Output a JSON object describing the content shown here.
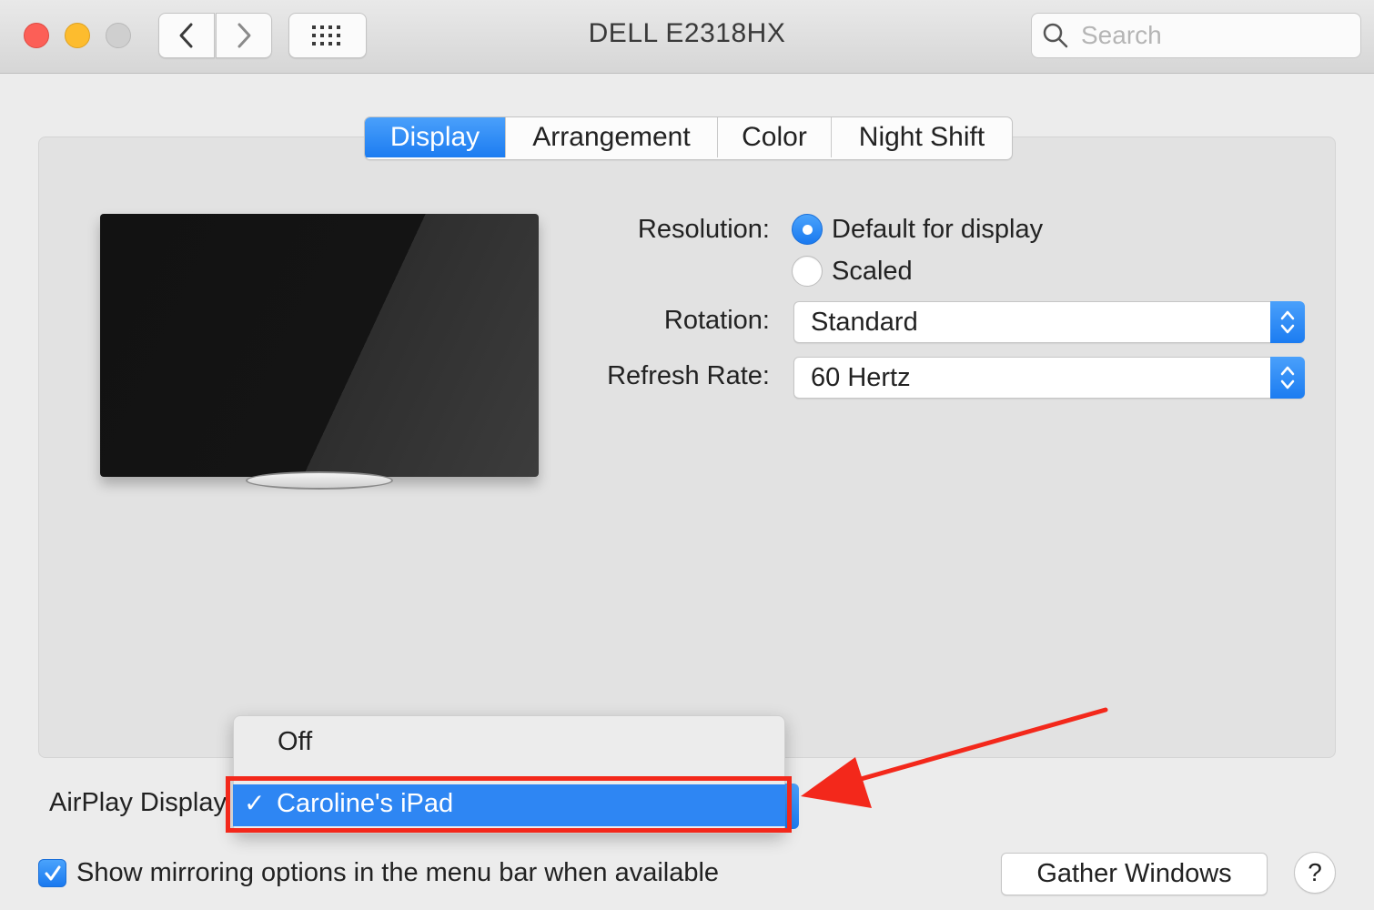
{
  "window": {
    "title": "DELL E2318HX"
  },
  "toolbar": {
    "search_placeholder": "Search",
    "icons": {
      "back": "chevron-left-icon",
      "forward": "chevron-right-icon",
      "grid": "grid-icon",
      "search": "search-icon"
    }
  },
  "tabs": [
    {
      "label": "Display",
      "active": true
    },
    {
      "label": "Arrangement",
      "active": false
    },
    {
      "label": "Color",
      "active": false
    },
    {
      "label": "Night Shift",
      "active": false
    }
  ],
  "display": {
    "resolution_label": "Resolution:",
    "resolution_options": [
      {
        "label": "Default for display",
        "selected": true
      },
      {
        "label": "Scaled",
        "selected": false
      }
    ],
    "rotation_label": "Rotation:",
    "rotation_value": "Standard",
    "refresh_label": "Refresh Rate:",
    "refresh_value": "60 Hertz"
  },
  "airplay": {
    "label": "AirPlay Display",
    "menu": [
      {
        "label": "Off",
        "selected": false
      },
      {
        "label": "Caroline's iPad",
        "selected": true
      }
    ],
    "check_glyph": "✓"
  },
  "mirroring": {
    "label": "Show mirroring options in the menu bar when available",
    "checked": true
  },
  "buttons": {
    "gather": "Gather Windows",
    "help": "?"
  },
  "colors": {
    "accent": "#1c7cf1",
    "annotation": "#f3281b"
  }
}
